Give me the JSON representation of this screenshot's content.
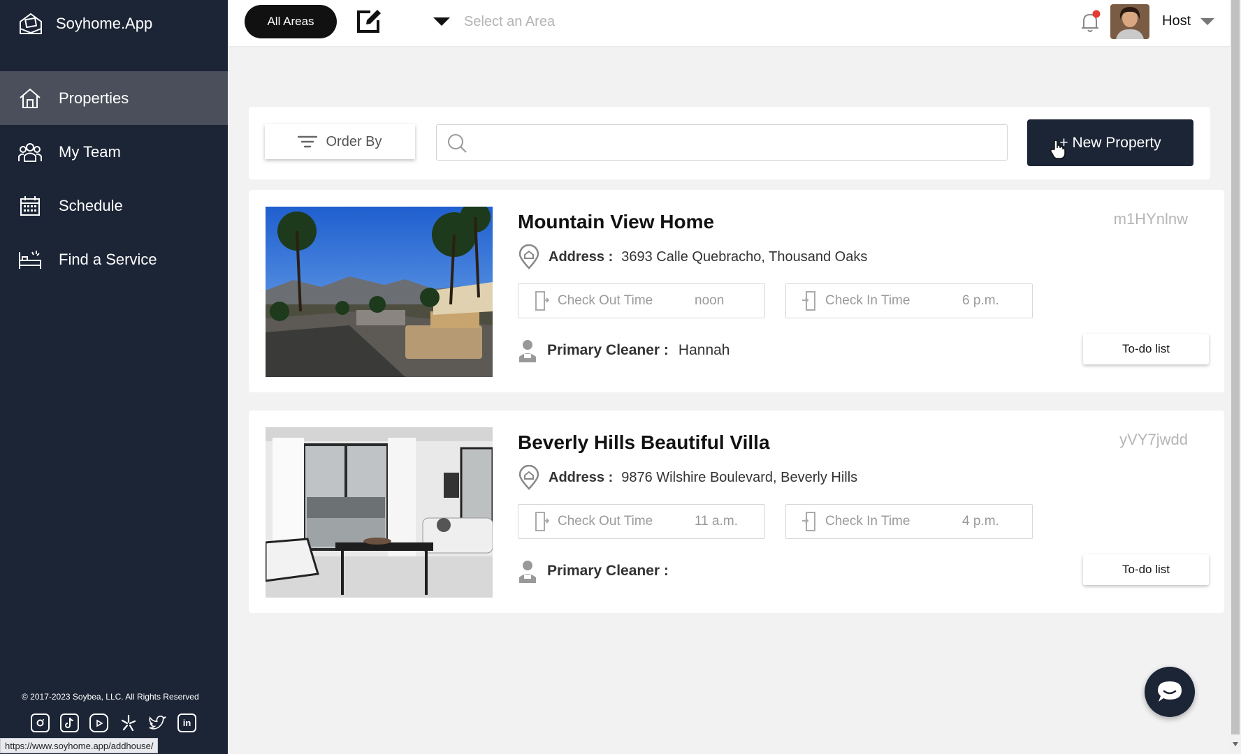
{
  "brand": {
    "name": "Soyhome.App"
  },
  "sidebar": {
    "items": [
      {
        "label": "Properties",
        "icon": "home-icon",
        "active": true
      },
      {
        "label": "My Team",
        "icon": "team-icon"
      },
      {
        "label": "Schedule",
        "icon": "calendar-icon"
      },
      {
        "label": "Find a Service",
        "icon": "service-icon"
      }
    ],
    "copyright": "© 2017-2023 Soybea, LLC. All Rights Reserved",
    "socials": [
      "instagram-icon",
      "tiktok-icon",
      "youtube-icon",
      "yelp-icon",
      "twitter-icon",
      "linkedin-icon"
    ]
  },
  "status_url": "https://www.soyhome.app/addhouse/",
  "topbar": {
    "all_areas_label": "All Areas",
    "area_placeholder": "Select an Area",
    "user_label": "Host"
  },
  "toolbar": {
    "order_by_label": "Order By",
    "search_placeholder": "",
    "new_property_label": "+ New Property"
  },
  "properties": [
    {
      "title": "Mountain View Home",
      "code": "m1HYnlnw",
      "address_label": "Address :",
      "address": "3693 Calle Quebracho, Thousand Oaks",
      "checkout_label": "Check Out Time",
      "checkout_value": "noon",
      "checkin_label": "Check In Time",
      "checkin_value": "6 p.m.",
      "cleaner_label": "Primary Cleaner :",
      "cleaner": "Hannah",
      "todo_label": "To-do list"
    },
    {
      "title": "Beverly Hills Beautiful Villa",
      "code": "yVY7jwdd",
      "address_label": "Address :",
      "address": "9876 Wilshire Boulevard, Beverly Hills",
      "checkout_label": "Check Out Time",
      "checkout_value": "11 a.m.",
      "checkin_label": "Check In Time",
      "checkin_value": "4 p.m.",
      "cleaner_label": "Primary Cleaner :",
      "cleaner": "",
      "todo_label": "To-do list"
    }
  ],
  "colors": {
    "sidebar_bg": "#1c2536",
    "sidebar_active": "#4a4f5b",
    "accent_button": "#1c2536",
    "notification_dot": "#e53935"
  }
}
